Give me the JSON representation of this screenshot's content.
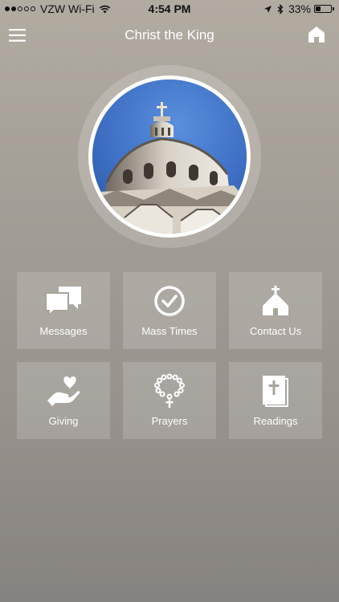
{
  "status_bar": {
    "carrier": "VZW Wi-Fi",
    "time": "4:54 PM",
    "battery_percent": "33%",
    "battery_level": 0.33,
    "signal_bars_filled": 2,
    "signal_bars_total": 5
  },
  "nav": {
    "title": "Christ the King",
    "menu_icon": "hamburger-menu-icon",
    "home_icon": "home-icon"
  },
  "hero": {
    "image": "church-dome-photo"
  },
  "tiles": [
    {
      "label": "Messages",
      "icon": "chat-bubbles-icon"
    },
    {
      "label": "Mass Times",
      "icon": "clock-check-icon"
    },
    {
      "label": "Contact Us",
      "icon": "chapel-icon"
    },
    {
      "label": "Giving",
      "icon": "hand-heart-icon"
    },
    {
      "label": "Prayers",
      "icon": "rosary-icon"
    },
    {
      "label": "Readings",
      "icon": "bible-icon"
    }
  ],
  "colors": {
    "background_top": "#b1aba0",
    "background_bottom": "#86827f",
    "text": "#ffffff",
    "sky": "#3f73c6"
  }
}
